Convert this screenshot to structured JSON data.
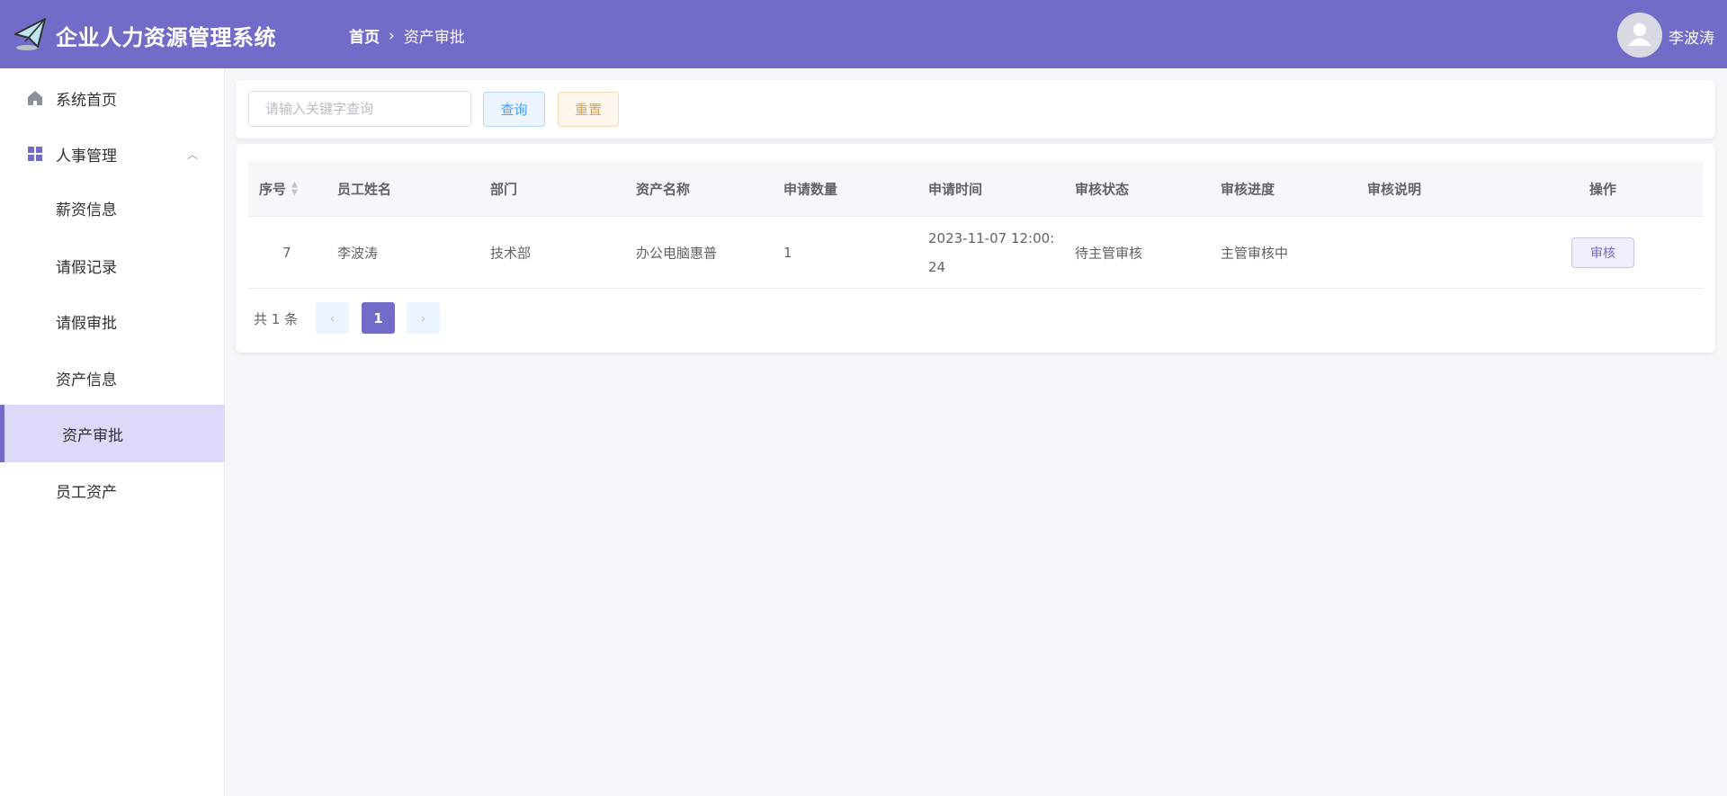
{
  "header": {
    "title": "企业人力资源管理系统",
    "breadcrumb": [
      "首页",
      "资产审批"
    ],
    "user_name": "李波涛"
  },
  "sidebar": {
    "items": [
      {
        "label": "系统首页",
        "icon": "home-icon"
      },
      {
        "label": "人事管理",
        "icon": "grid-icon",
        "expanded": true
      },
      {
        "label": "薪资信息"
      },
      {
        "label": "请假记录"
      },
      {
        "label": "请假审批"
      },
      {
        "label": "资产信息"
      },
      {
        "label": "资产审批",
        "active": true
      },
      {
        "label": "员工资产"
      }
    ]
  },
  "search": {
    "placeholder": "请输入关键字查询",
    "value": "",
    "query_label": "查询",
    "reset_label": "重置"
  },
  "table": {
    "columns": [
      "序号",
      "员工姓名",
      "部门",
      "资产名称",
      "申请数量",
      "申请时间",
      "审核状态",
      "审核进度",
      "审核说明",
      "操作"
    ],
    "rows": [
      {
        "id": "7",
        "name": "李波涛",
        "dept": "技术部",
        "asset": "办公电脑惠普",
        "qty": "1",
        "time_line1": "2023-11-07 12:00:",
        "time_line2": "24",
        "status": "待主管审核",
        "progress": "主管审核中",
        "note": "",
        "action": "审核"
      }
    ]
  },
  "pagination": {
    "total": "共 1 条",
    "current": "1",
    "prev": "‹",
    "next": "›"
  },
  "colors": {
    "brand": "#736bc8",
    "active_bg": "#dcd9fa"
  }
}
